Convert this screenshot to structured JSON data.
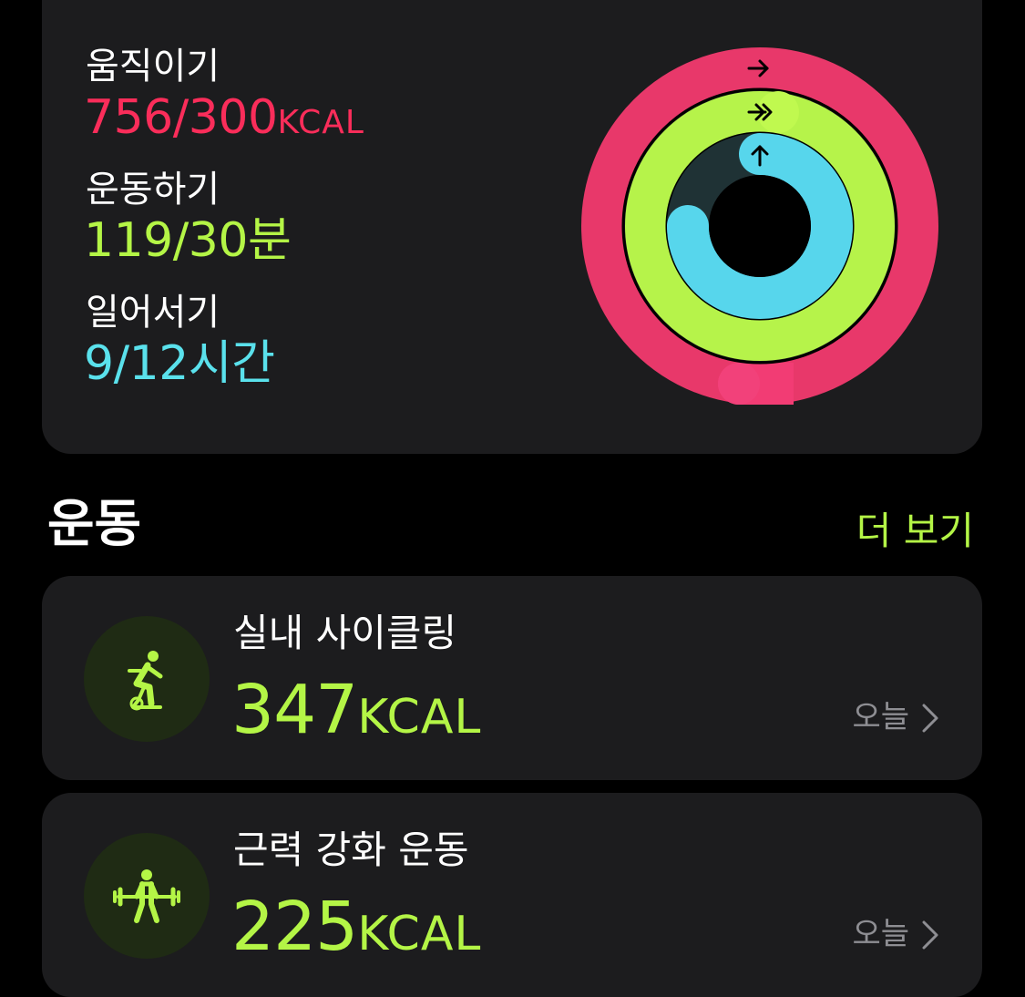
{
  "activity": {
    "move": {
      "label": "움직이기",
      "value": "756/300",
      "unit": "KCAL",
      "current": 756,
      "goal": 300,
      "color": "#fa2d5a"
    },
    "exercise": {
      "label": "운동하기",
      "value": "119/30",
      "unit": "분",
      "current": 119,
      "goal": 30,
      "color": "#b4f546"
    },
    "stand": {
      "label": "일어서기",
      "value": "9/12",
      "unit": "시간",
      "current": 9,
      "goal": 12,
      "color": "#5ae1ec"
    }
  },
  "workouts_section": {
    "title": "운동",
    "see_more": "더 보기"
  },
  "workouts": [
    {
      "name": "실내 사이클링",
      "value": "347",
      "unit": "KCAL",
      "date": "오늘",
      "icon": "indoor-cycle-icon"
    },
    {
      "name": "근력 강화 운동",
      "value": "225",
      "unit": "KCAL",
      "date": "오늘",
      "icon": "strength-training-icon"
    }
  ]
}
